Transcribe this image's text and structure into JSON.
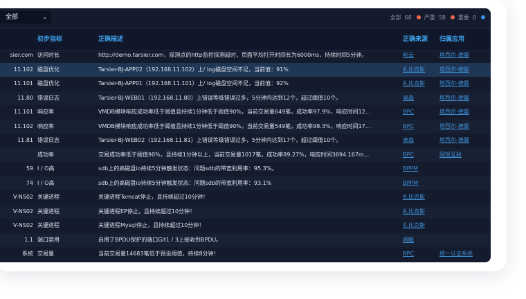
{
  "filter": {
    "selected": "全部"
  },
  "summary": [
    {
      "label": "全部",
      "count": "68",
      "color": "#f06a4a"
    },
    {
      "label": "严重",
      "count": "58",
      "color": "#f06a4a"
    },
    {
      "label": "重要",
      "count": "0",
      "color": "#3b8fea"
    }
  ],
  "columns": {
    "source": "",
    "indicator": "初步指标",
    "description": "正确描述",
    "origin": "正确来源",
    "app": "归属应用"
  },
  "rows": [
    {
      "source": "sier.com",
      "indicator": "访问时长",
      "description": "http://demo.tarsier.com，探测点的http监控探测超时，页面平均打开时间长为6000ms，持续时间5分钟。",
      "origin": "听云",
      "app": "塔西尔-德晨"
    },
    {
      "source": "11.102",
      "indicator": "磁盘优化",
      "description": "Tarsier-BJ-APP02（192.168.11.102）上/ log磁盘空间不足，当前值：91%",
      "origin": "扎比克斯",
      "app": "塔西尔-德晨"
    },
    {
      "source": "11.101",
      "indicator": "磁盘优化",
      "description": "Tarsier-BJ-APP01（192.168.11.101）上/ log磁盘空间不足，当前值：92%",
      "origin": "扎比克斯",
      "app": "塔西尔-德晨"
    },
    {
      "source": "11.80",
      "indicator": "错误日志",
      "description": "Tarsier-BJ-WEB01（192.168.11.80）上错误等级错误过多，5分钟内达到12个，超过阈值10个。",
      "origin": "奥森",
      "app": "塔西尔-德晨"
    },
    {
      "source": "11.101",
      "indicator": "响应率",
      "description": "VMDB模块响应成功率低于阈值且持续1分钟低于阈值90%，当前交易量649笔，成功率97.9%，响应时间12...",
      "origin": "BPC",
      "app": "塔西尔-德晨"
    },
    {
      "source": "11.102",
      "indicator": "响应率",
      "description": "VMDB模块响应成功率低于阈值且持续1分钟低于阈值90%，当前交易量549笔，成功率98.3%，响应时间17...",
      "origin": "BPC",
      "app": "塔西尔-德晨"
    },
    {
      "source": "11.81",
      "indicator": "错误日志",
      "description": "Tarsier-BJ-WEB02（192.168.11.81）上错误等级错误过多，5分钟内达到17个，超过阈值10个。",
      "origin": "奥森",
      "app": "塔西尔-德晨"
    },
    {
      "source": "",
      "indicator": "成功率",
      "description": "交易成功率低于阈值90%，且持续1分钟以上，当前交易量1017笔，成功率89.27%，响应时间3694.167m...",
      "origin": "BPC",
      "app": "网银互联"
    },
    {
      "source": "59",
      "indicator": "I / O高",
      "description": "sdb上的高磁盘io持续5分钟触发状态：问题sdb的带宽利用率：95.3%。",
      "origin": "BPPM",
      "app": ""
    },
    {
      "source": "74",
      "indicator": "I / O高",
      "description": "sdb上的高磁盘io持续5分钟触发状态：问题sdb的带宽利用率：93.1%",
      "origin": "BPPM",
      "app": ""
    },
    {
      "source": "V-NS02",
      "indicator": "关键进程",
      "description": "关键进程Tomcat停止，且持续超过10分钟！",
      "origin": "扎比克斯",
      "app": ""
    },
    {
      "source": "V-NS02",
      "indicator": "关键进程",
      "description": "关键进程EP停止，且持续超过10分钟！",
      "origin": "扎比克斯",
      "app": ""
    },
    {
      "source": "V-NS02",
      "indicator": "关键进程",
      "description": "关键进程Mysql停止，且持续超过10分钟！",
      "origin": "扎比克斯",
      "app": ""
    },
    {
      "source": "1.1",
      "indicator": "端口禁用",
      "description": "启用了BPDU保护的端口Git1 / 3上接收到BPDU。",
      "origin": "网酷",
      "app": ""
    },
    {
      "source": "系统",
      "indicator": "交易量",
      "description": "当前交易量14683笔低于预设阈值，持续8分钟！",
      "origin": "BPC",
      "app": "统一认证系统"
    }
  ]
}
